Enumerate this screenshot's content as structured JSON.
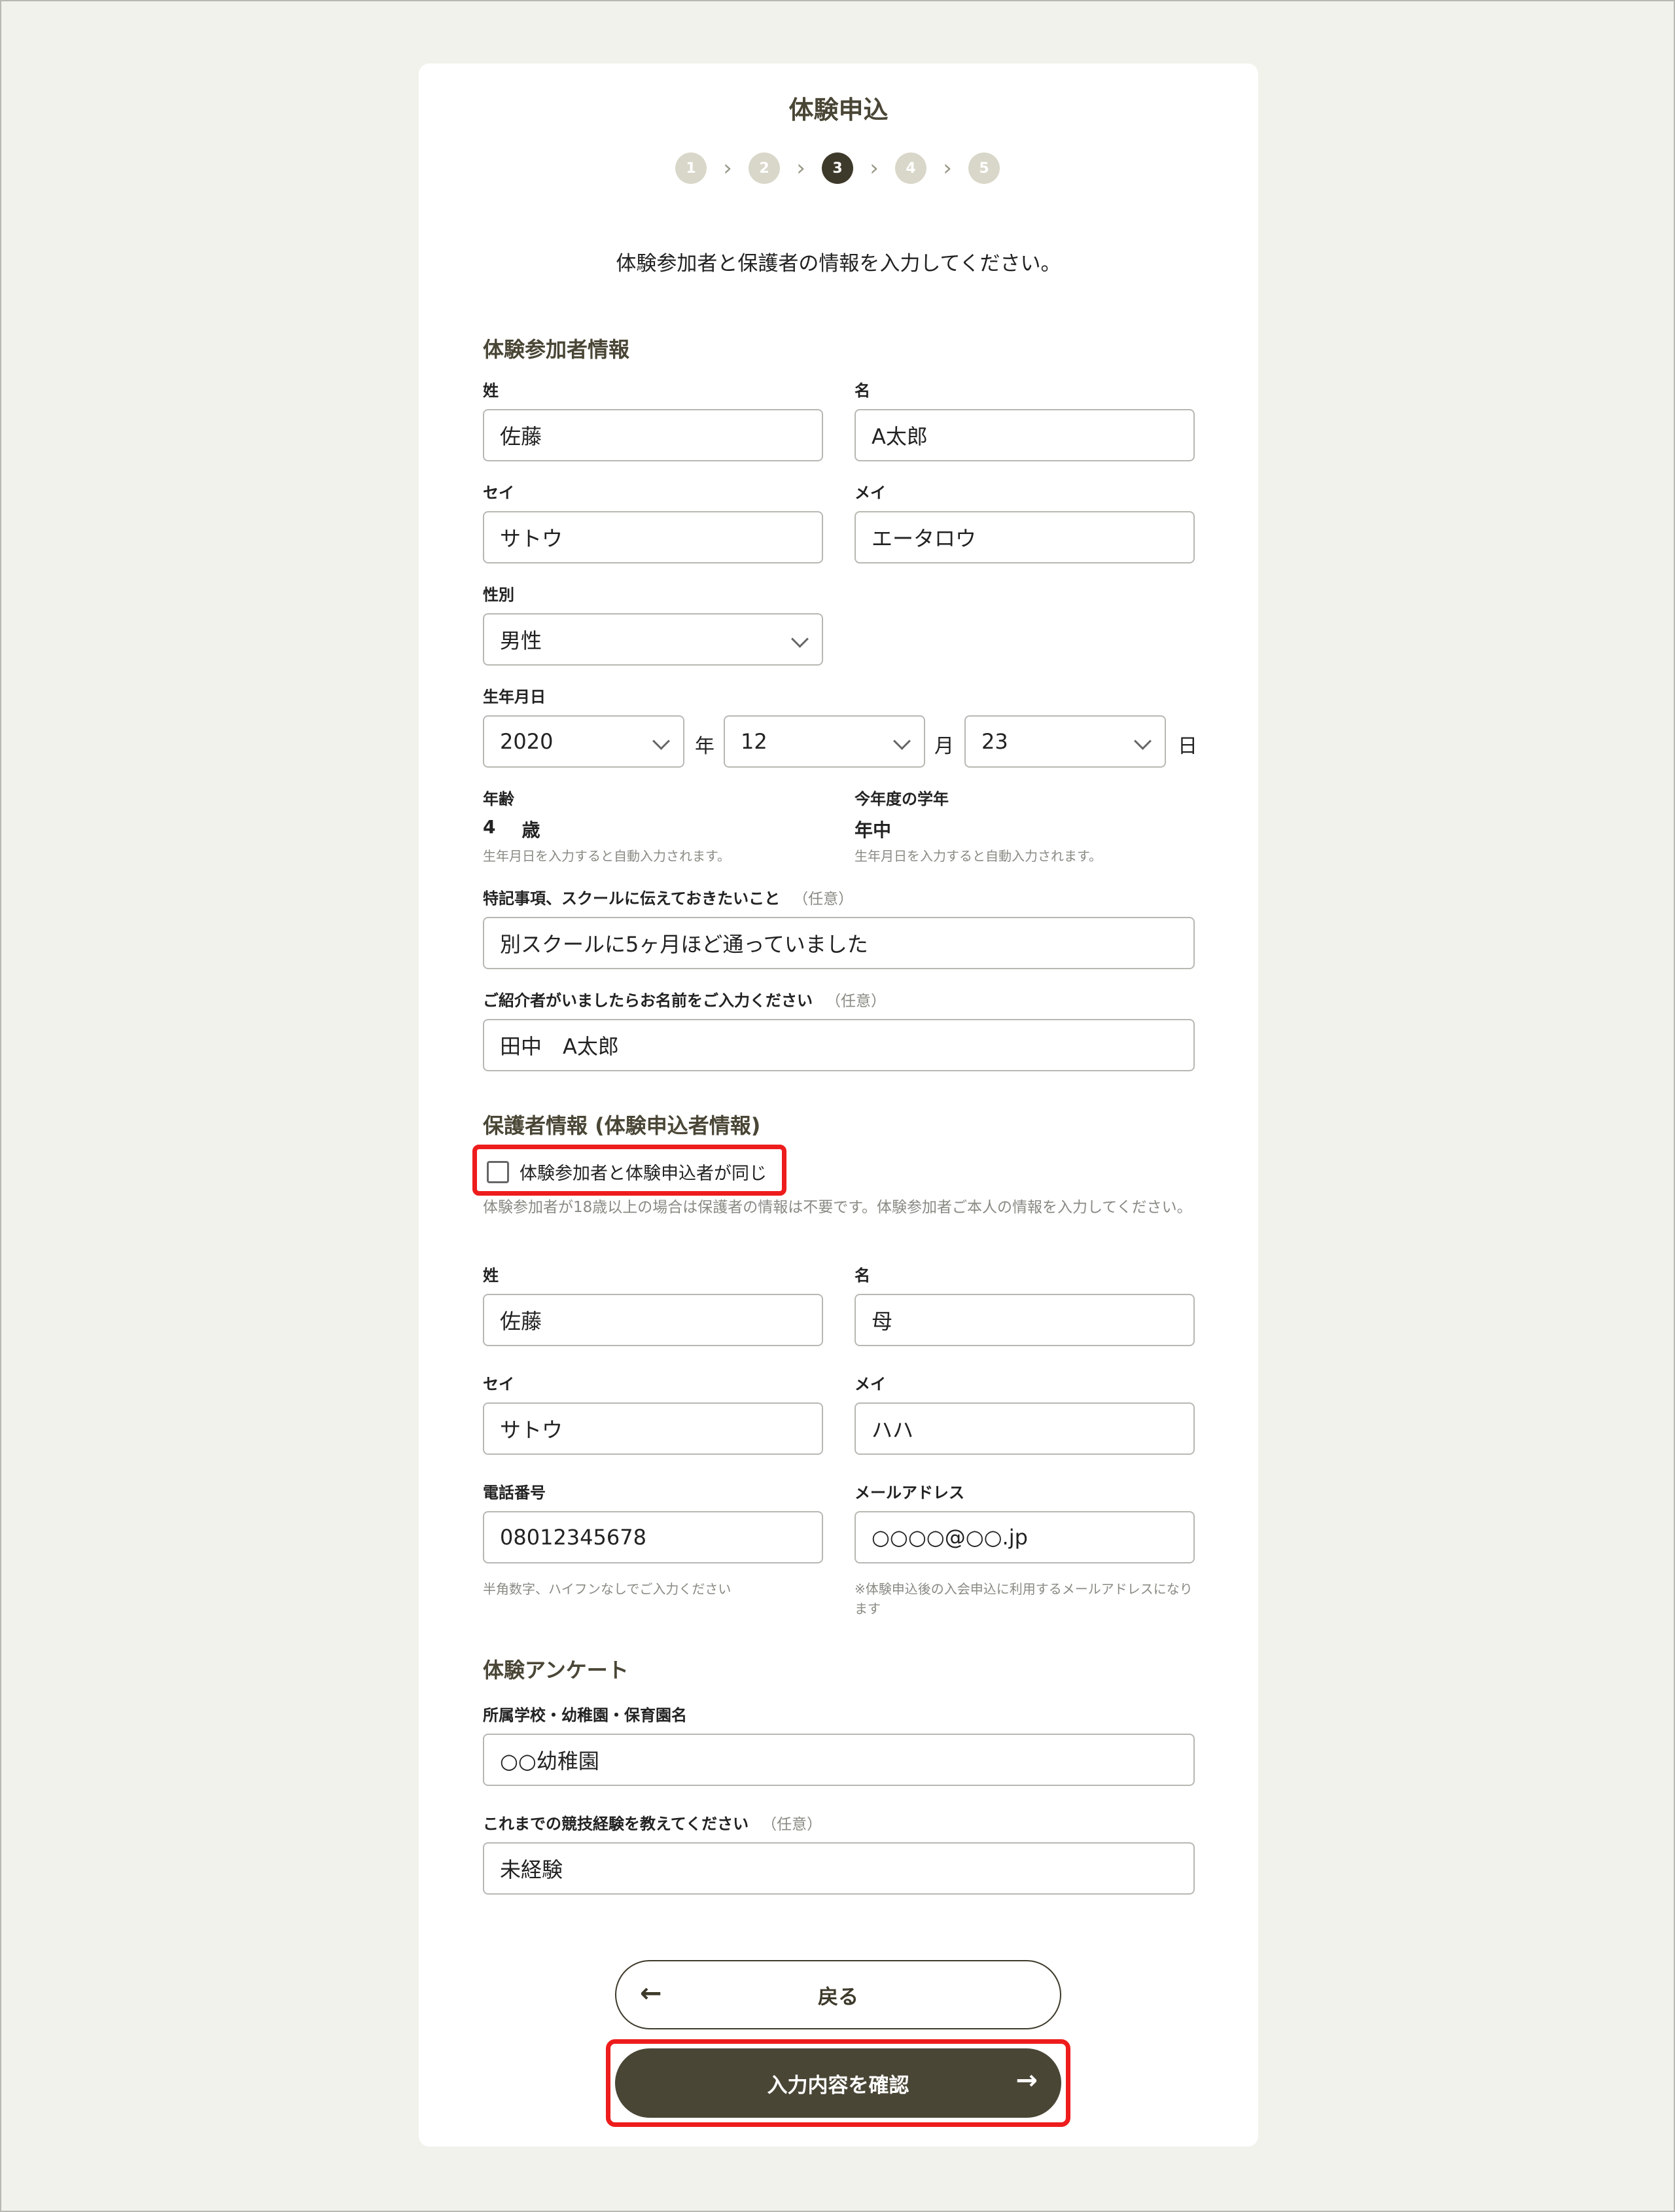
{
  "header": {
    "title": "体験申込"
  },
  "steps": [
    "1",
    "2",
    "3",
    "4",
    "5"
  ],
  "lead": "体験参加者と保護者の情報を入力してください。",
  "participant": {
    "section_title": "体験参加者情報",
    "last_name": {
      "label": "姓",
      "value": "佐藤"
    },
    "first_name": {
      "label": "名",
      "value": "A太郎"
    },
    "last_kana": {
      "label": "セイ",
      "value": "サトウ"
    },
    "first_kana": {
      "label": "メイ",
      "value": "エータロウ"
    },
    "gender": {
      "label": "性別",
      "value": "男性"
    },
    "birthdate": {
      "label": "生年月日",
      "year": "2020",
      "year_unit": "年",
      "month": "12",
      "month_unit": "月",
      "day": "23",
      "day_unit": "日"
    },
    "age": {
      "label": "年齢",
      "value": "4",
      "unit": "歳",
      "hint": "生年月日を入力すると自動入力されます。"
    },
    "grade": {
      "label": "今年度の学年",
      "value": "年中",
      "hint": "生年月日を入力すると自動入力されます。"
    },
    "notes": {
      "label": "特記事項、スクールに伝えておきたいこと",
      "optional": "（任意）",
      "value": "別スクールに5ヶ月ほど通っていました"
    },
    "referrer": {
      "label": "ご紹介者がいましたらお名前をご入力ください",
      "optional": "（任意）",
      "value": "田中　A太郎"
    }
  },
  "guardian": {
    "section_title": "保護者情報 (体験申込者情報)",
    "same_checkbox": {
      "label": "体験参加者と体験申込者が同じ",
      "checked": false
    },
    "note": "体験参加者が18歳以上の場合は保護者の情報は不要です。体験参加者ご本人の情報を入力してください。",
    "last_name": {
      "label": "姓",
      "value": "佐藤"
    },
    "first_name": {
      "label": "名",
      "value": "母"
    },
    "last_kana": {
      "label": "セイ",
      "value": "サトウ"
    },
    "first_kana": {
      "label": "メイ",
      "value": "ハハ"
    },
    "phone": {
      "label": "電話番号",
      "value": "08012345678",
      "hint": "半角数字、ハイフンなしでご入力ください"
    },
    "email": {
      "label": "メールアドレス",
      "value": "○○○○@○○.jp",
      "hint": "※体験申込後の入会申込に利用するメールアドレスになります"
    }
  },
  "survey": {
    "section_title": "体験アンケート",
    "school": {
      "label": "所属学校・幼稚園・保育園名",
      "value": "○○幼稚園"
    },
    "experience": {
      "label": "これまでの競技経験を教えてください",
      "optional": "（任意）",
      "value": "未経験"
    }
  },
  "buttons": {
    "back": "戻る",
    "confirm": "入力内容を確認"
  },
  "colors": {
    "accent": "#4a4636",
    "highlight": "#ee1c1c",
    "background": "#f2f2ec"
  }
}
